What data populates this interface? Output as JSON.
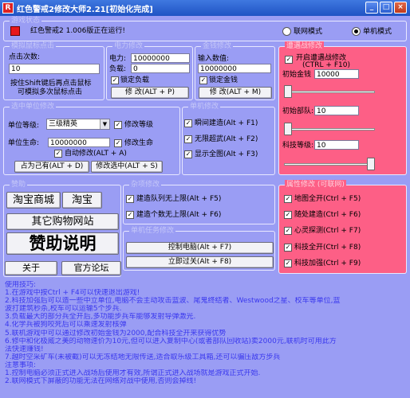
{
  "window": {
    "title": "红色警戒2修改大师2.21[初始化完成]",
    "app_icon_text": "R",
    "minimize": "_",
    "maximize": "□",
    "close": "×"
  },
  "status": {
    "group_label": "游戏状态",
    "text": "红色警戒2 1.006版正在运行!",
    "mode_network": "联网模式",
    "mode_single": "单机模式",
    "selected_mode": "单机模式",
    "indicator_color": "#e8181c"
  },
  "mouse": {
    "group_label": "模拟鼠标点击",
    "clicks_label": "点击次数:",
    "clicks_value": "10",
    "hint_line1": "按住Shift键后再点击鼠标",
    "hint_line2": "可模拟多次鼠标点击"
  },
  "power": {
    "group_label": "电力修改",
    "power_label": "电力:",
    "power_value": "10000000",
    "load_label": "负载:",
    "load_value": "0",
    "lock_label": "锁定负载",
    "lock_checked": true,
    "modify_button": "修 改(ALT + P)"
  },
  "money": {
    "group_label": "金钱修改",
    "input_label": "输入数值:",
    "input_value": "10000000",
    "lock_label": "锁定金钱",
    "lock_checked": true,
    "modify_button": "修 改(ALT + M)"
  },
  "tech": {
    "group_label": "遭遇战修改",
    "open_label_line1": "开启遭遇战修改",
    "open_label_line2": "(CTRL + F10)",
    "open_checked": true,
    "init_money_label": "初始金钱",
    "init_money_value": "10000",
    "init_units_label": "初始部队:",
    "init_units_value": "10",
    "tech_level_label": "科技等级:",
    "tech_level_value": "10",
    "slider1_level": 0.0,
    "slider2_level": 0.0,
    "slider3_level": 1.0
  },
  "unit": {
    "group_label": "选中单位修改",
    "level_label": "单位等级:",
    "level_value": "三级精英",
    "modify_level": "修改等级",
    "modify_level_checked": true,
    "life_label": "单位生命:",
    "life_value": "10000000",
    "modify_life": "修改生命",
    "modify_life_checked": true,
    "auto_modify": "自动修改(ALT + A)",
    "auto_checked": true,
    "own_button": "占为己有(ALT + D)",
    "modify_sel_button": "修改选中(ALT + S)"
  },
  "build": {
    "group_label": "单机修改",
    "items": [
      {
        "label": "瞬间建造(Alt + F1)",
        "checked": true
      },
      {
        "label": "无限超武(Alt + F2)",
        "checked": true
      },
      {
        "label": "显示全图(Alt + F3)",
        "checked": true
      }
    ]
  },
  "sponsor": {
    "group_label": "赞助",
    "taobao_mall": "淘宝商城",
    "taobao": "淘宝",
    "other_sites": "其它购物网站",
    "sponsor_info": "赞助说明",
    "about": "关于",
    "forum": "官方论坛"
  },
  "misc": {
    "group_label": "杂项修改",
    "items": [
      {
        "label": "建造队列无上限(Alt + F5)",
        "checked": true
      },
      {
        "label": "建造个数无上限(Alt + F6)",
        "checked": true
      }
    ]
  },
  "mission": {
    "group_label": "单机任务修改",
    "control_button": "控制电脑(Alt + F7)",
    "win_button": "立即过关(Alt + F8)"
  },
  "attr": {
    "group_label": "属性修改 (可联网)",
    "items": [
      {
        "label": "地图全开(Ctrl + F5)",
        "checked": true
      },
      {
        "label": "随处建造(Ctrl + F6)",
        "checked": true
      },
      {
        "label": "心灵探测(Ctrl + F7)",
        "checked": true
      },
      {
        "label": "科技全开(Ctrl + F8)",
        "checked": true
      },
      {
        "label": "科技加强(Ctrl + F9)",
        "checked": true
      }
    ]
  },
  "tips": {
    "lines": [
      "使用技巧:",
      "1.在游戏中按Ctrl + F4可以快速退出游戏!",
      "2.科技加强后可以造一些中立单位,电脑不会主动攻击蓝波、尾鬼终结者、Westwood之星、校车等单位,蓝",
      "波打建筑秒杀,校车可以运输5个步兵.",
      "3.负载最大的部分兵全开后,多功能步兵车能够发射导弹激光.",
      "4.化学兵被狗咬死后可以乘速发射核弹",
      "5.联机游戏中可以通过修改初始金钱为2000,配合科技全开来获得优势",
      "6.修中和化极威之美的动物速价为10元,但可以进入复制中心(或者部队回收站)卖2000元,联机时可用此方",
      "法快速赚钱!",
      "7.越时空采矿车(未被截)可以无冻结地无限传送,适合取乐级工具箱,还可以骗压敌方步兵",
      "注意事项:",
      "1.控制电脑必须正式进入战场后使用才有效,所谓正式进入战场就是游戏正式开始.",
      "2.联网模式下屏蔽的功能无法在网络对战中使用,否则会掉线!"
    ]
  }
}
